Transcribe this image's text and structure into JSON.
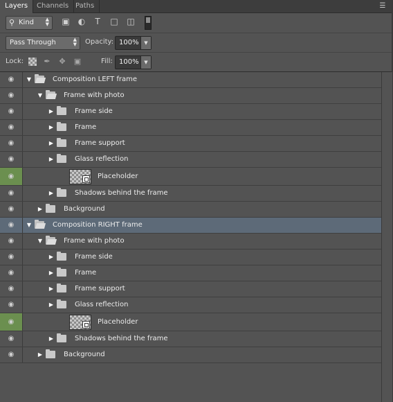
{
  "tabs": [
    {
      "label": "Layers",
      "active": true
    },
    {
      "label": "Channels",
      "active": false
    },
    {
      "label": "Paths",
      "active": false
    }
  ],
  "panel_menu_icon": "panel-menu-icon",
  "filter": {
    "kind_label": "Kind",
    "icons": [
      "pixel-layer-filter-icon",
      "adjustment-layer-filter-icon",
      "type-layer-filter-icon",
      "shape-layer-filter-icon",
      "smart-object-filter-icon"
    ]
  },
  "blend": {
    "mode": "Pass Through",
    "opacity_label": "Opacity:",
    "opacity_value": "100%"
  },
  "lock": {
    "label": "Lock:",
    "icons": [
      "lock-transparent-pixels-icon",
      "lock-image-pixels-icon",
      "lock-position-icon",
      "lock-all-icon"
    ],
    "fill_label": "Fill:",
    "fill_value": "100%"
  },
  "colors": {
    "panel_bg": "#535353",
    "selected_row": "#5d6a78",
    "visibility_highlight": "#6b8f4f"
  },
  "layers": [
    {
      "name": "Composition LEFT frame",
      "type": "group",
      "expanded": true,
      "depth": 0,
      "selected": false,
      "eye_highlight": false
    },
    {
      "name": "Frame with photo",
      "type": "group",
      "expanded": true,
      "depth": 1,
      "selected": false,
      "eye_highlight": false
    },
    {
      "name": "Frame side",
      "type": "group",
      "expanded": false,
      "depth": 2,
      "selected": false,
      "eye_highlight": false
    },
    {
      "name": "Frame",
      "type": "group",
      "expanded": false,
      "depth": 2,
      "selected": false,
      "eye_highlight": false
    },
    {
      "name": "Frame support",
      "type": "group",
      "expanded": false,
      "depth": 2,
      "selected": false,
      "eye_highlight": false
    },
    {
      "name": "Glass reflection",
      "type": "group",
      "expanded": false,
      "depth": 2,
      "selected": false,
      "eye_highlight": false
    },
    {
      "name": "Placeholder",
      "type": "smart",
      "depth": 2,
      "selected": false,
      "eye_highlight": true
    },
    {
      "name": "Shadows behind the frame",
      "type": "group",
      "expanded": false,
      "depth": 2,
      "selected": false,
      "eye_highlight": false
    },
    {
      "name": "Background",
      "type": "group",
      "expanded": false,
      "depth": 1,
      "selected": false,
      "eye_highlight": false
    },
    {
      "name": "Composition RIGHT frame",
      "type": "group",
      "expanded": true,
      "depth": 0,
      "selected": true,
      "eye_highlight": false
    },
    {
      "name": "Frame with photo",
      "type": "group",
      "expanded": true,
      "depth": 1,
      "selected": false,
      "eye_highlight": false
    },
    {
      "name": "Frame side",
      "type": "group",
      "expanded": false,
      "depth": 2,
      "selected": false,
      "eye_highlight": false
    },
    {
      "name": "Frame",
      "type": "group",
      "expanded": false,
      "depth": 2,
      "selected": false,
      "eye_highlight": false
    },
    {
      "name": "Frame support",
      "type": "group",
      "expanded": false,
      "depth": 2,
      "selected": false,
      "eye_highlight": false
    },
    {
      "name": "Glass reflection",
      "type": "group",
      "expanded": false,
      "depth": 2,
      "selected": false,
      "eye_highlight": false
    },
    {
      "name": "Placeholder",
      "type": "smart",
      "depth": 2,
      "selected": false,
      "eye_highlight": true
    },
    {
      "name": "Shadows behind the frame",
      "type": "group",
      "expanded": false,
      "depth": 2,
      "selected": false,
      "eye_highlight": false
    },
    {
      "name": "Background",
      "type": "group",
      "expanded": false,
      "depth": 1,
      "selected": false,
      "eye_highlight": false
    }
  ]
}
